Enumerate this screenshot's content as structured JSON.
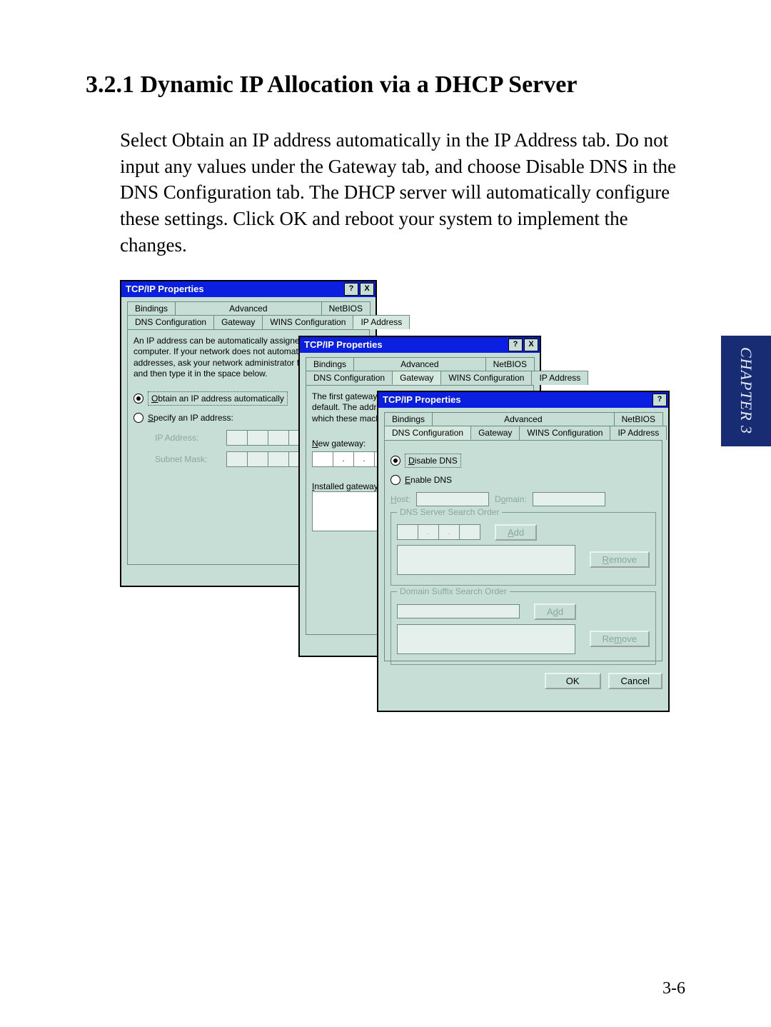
{
  "heading": "3.2.1 Dynamic IP Allocation via a DHCP Server",
  "paragraph": "Select Obtain an IP address automatically in the IP Address tab. Do not input any values under the Gateway tab, and choose Disable DNS in the DNS Configuration tab. The DHCP server will automatically configure these settings. Click OK and reboot your system to implement the changes.",
  "side_tab": "CHAPTER 3",
  "page_number": "3-6",
  "dlg": {
    "title": "TCP/IP Properties",
    "help_btn": "?",
    "close_btn": "X",
    "tabs": {
      "bindings": "Bindings",
      "advanced": "Advanced",
      "netbios": "NetBIOS",
      "dnsconf": "DNS Configuration",
      "gateway": "Gateway",
      "winsconf": "WINS Configuration",
      "ipaddr": "IP Address"
    }
  },
  "ipaddr_panel": {
    "desc": "An IP address can be automatically assigned to this computer. If your network does not automatically assign IP addresses, ask your network administrator for an address, and then type it in the space below.",
    "opt_auto": "Obtain an IP address automatically",
    "opt_spec": "Specify an IP address:",
    "lbl_ip": "IP Address:",
    "lbl_mask": "Subnet Mask:"
  },
  "gateway_panel": {
    "desc": "The first gateway in the Installed Gateway list will be the default. The address order in the list will be the order in which these machines are used.",
    "lbl_new": "New gateway:",
    "lbl_installed": "Installed gateways:"
  },
  "dns_panel": {
    "opt_disable": "Disable DNS",
    "opt_enable": "Enable DNS",
    "lbl_host": "Host:",
    "lbl_domain": "Domain:",
    "grp_dns": "DNS Server Search Order",
    "grp_suffix": "Domain Suffix Search Order",
    "btn_add": "Add",
    "btn_remove": "Remove"
  },
  "btns": {
    "ok": "OK",
    "cancel": "Cancel"
  }
}
